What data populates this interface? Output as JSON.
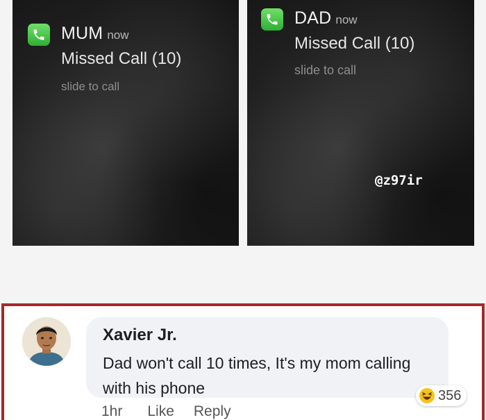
{
  "notifications": [
    {
      "caller": "MUM",
      "time": "now",
      "message": "Missed Call (10)",
      "action_hint": "slide to call",
      "icon": "phone-app-icon"
    },
    {
      "caller": "DAD",
      "time": "now",
      "message": "Missed Call (10)",
      "action_hint": "slide to call",
      "icon": "phone-app-icon"
    }
  ],
  "watermark": "@z97ir",
  "comment": {
    "author": "Xavier Jr.",
    "text": "Dad won't call 10 times, It's my mom calling with his phone",
    "timestamp": "1hr",
    "like_label": "Like",
    "reply_label": "Reply",
    "reaction": {
      "icon": "laughing-emoji-icon",
      "count": "356"
    }
  },
  "colors": {
    "highlight_border": "#a8272b",
    "phone_icon_green": "#34c759",
    "bubble_bg": "#f0f2f5"
  }
}
